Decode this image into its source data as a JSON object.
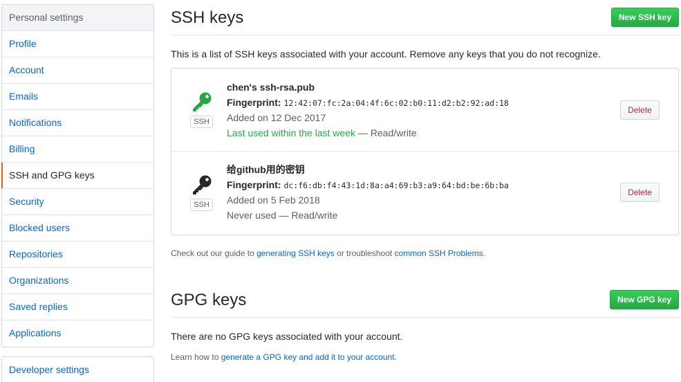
{
  "sidebar": {
    "heading": "Personal settings",
    "items": [
      {
        "label": "Profile"
      },
      {
        "label": "Account"
      },
      {
        "label": "Emails"
      },
      {
        "label": "Notifications"
      },
      {
        "label": "Billing"
      },
      {
        "label": "SSH and GPG keys",
        "selected": true
      },
      {
        "label": "Security"
      },
      {
        "label": "Blocked users"
      },
      {
        "label": "Repositories"
      },
      {
        "label": "Organizations"
      },
      {
        "label": "Saved replies"
      },
      {
        "label": "Applications"
      }
    ],
    "developer_settings": "Developer settings"
  },
  "ssh": {
    "title": "SSH keys",
    "new_button": "New SSH key",
    "intro": "This is a list of SSH keys associated with your account. Remove any keys that you do not recognize.",
    "keys": [
      {
        "title": "chen's ssh-rsa.pub",
        "fingerprint_label": "Fingerprint:",
        "fingerprint": "12:42:07:fc:2a:04:4f:6c:02:b0:11:d2:b2:92:ad:18",
        "added": "Added on 12 Dec 2017",
        "last_used": "Last used within the last week",
        "access": " — Read/write",
        "badge": "SSH",
        "delete": "Delete",
        "icon_color": "#28a745"
      },
      {
        "title": "给github用的密钥",
        "fingerprint_label": "Fingerprint:",
        "fingerprint": "dc:f6:db:f4:43:1d:8a:a4:69:b3:a9:64:bd:be:6b:ba",
        "added": "Added on 5 Feb 2018",
        "last_used": "Never used",
        "access": " — Read/write",
        "badge": "SSH",
        "delete": "Delete",
        "icon_color": "#24292e"
      }
    ],
    "guide": {
      "prefix": "Check out our guide to ",
      "link1": "generating SSH keys",
      "middle": " or troubleshoot ",
      "link2": "common SSH Problems",
      "suffix": "."
    }
  },
  "gpg": {
    "title": "GPG keys",
    "new_button": "New GPG key",
    "empty": "There are no GPG keys associated with your account.",
    "learn": {
      "prefix": "Learn how to ",
      "link": "generate a GPG key and add it to your account",
      "suffix": "."
    }
  },
  "colors": {
    "accent_selected": "#e36209",
    "link": "#0366d6",
    "green": "#28a745",
    "danger": "#cb2431"
  }
}
